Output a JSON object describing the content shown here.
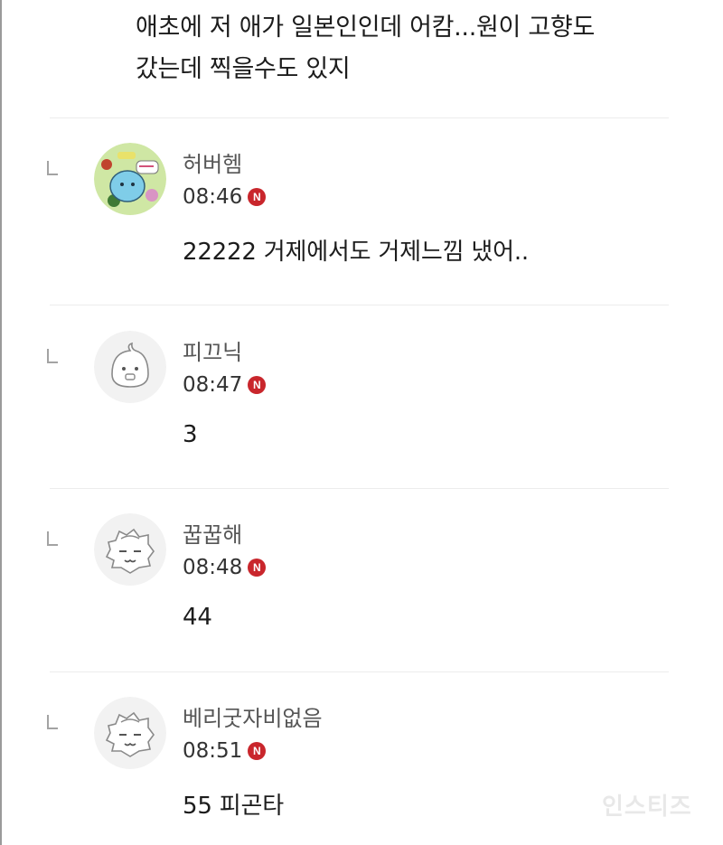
{
  "parent_comment": {
    "line1": "애초에 저 애가 일본인인데 어캄...원이 고향도",
    "line2": "갔는데 찍을수도 있지"
  },
  "replies": [
    {
      "nickname": "허버헴",
      "time": "08:46",
      "badge": "N",
      "text": "22222 거제에서도 거제느낌 냈어..",
      "avatar": "green-cartoon-sticker-avatar"
    },
    {
      "nickname": "피끄닉",
      "time": "08:47",
      "badge": "N",
      "text": "3",
      "avatar": "default-face-avatar"
    },
    {
      "nickname": "꿉꿉해",
      "time": "08:48",
      "badge": "N",
      "text": "44",
      "avatar": "spiky-cat-avatar"
    },
    {
      "nickname": "베리굿자비없음",
      "time": "08:51",
      "badge": "N",
      "text": "55 피곤타",
      "avatar": "spiky-cat-avatar"
    }
  ],
  "watermark": "인스티즈",
  "colors": {
    "badge": "#c9262c",
    "nickname": "#555555",
    "text": "#1c1c1c",
    "divider": "#ececec"
  }
}
